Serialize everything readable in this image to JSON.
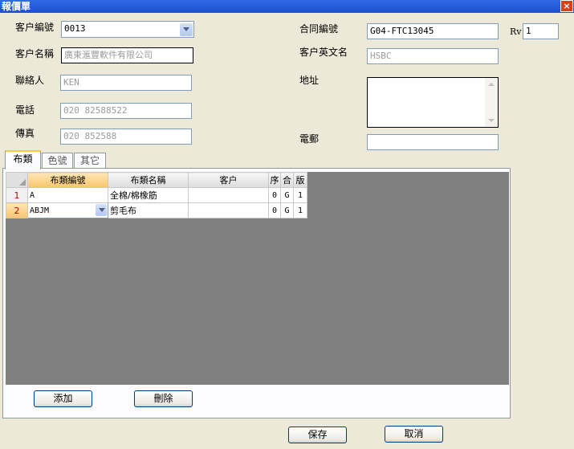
{
  "window": {
    "title": "報價單",
    "close_glyph": "×"
  },
  "form": {
    "customer_code_label": "客户編號",
    "customer_code_value": "0013",
    "customer_name_label": "客户名稱",
    "customer_name_value": "廣東滙豐軟件有限公司",
    "contact_label": "聯絡人",
    "contact_value": "KEN",
    "phone_label": "電話",
    "phone_value": "020 82588522",
    "fax_label": "傳真",
    "fax_value": "020 852588",
    "contract_no_label": "合同編號",
    "contract_no_value": "G04-FTC13045",
    "rv_label": "Rv",
    "rv_value": "1",
    "customer_en_label": "客户英文名",
    "customer_en_value": "HSBC",
    "address_label": "地址",
    "email_label": "電郵",
    "email_value": ""
  },
  "tabs": [
    {
      "label": "布類",
      "active": true
    },
    {
      "label": "色號",
      "active": false
    },
    {
      "label": "其它",
      "active": false
    }
  ],
  "grid": {
    "columns": [
      "布類編號",
      "布類名稱",
      "客户",
      "序",
      "合",
      "版"
    ],
    "rows": [
      {
        "num": "1",
        "code": "A",
        "name": "全棉/棉橡筋",
        "customer": "",
        "seq": "0",
        "he": "G",
        "ban": "1"
      },
      {
        "num": "2",
        "code": "ABJM",
        "name": "剪毛布",
        "customer": "",
        "seq": "0",
        "he": "G",
        "ban": "1"
      }
    ]
  },
  "buttons": {
    "add": "添加",
    "delete": "刪除",
    "save": "保存",
    "cancel": "取消"
  }
}
